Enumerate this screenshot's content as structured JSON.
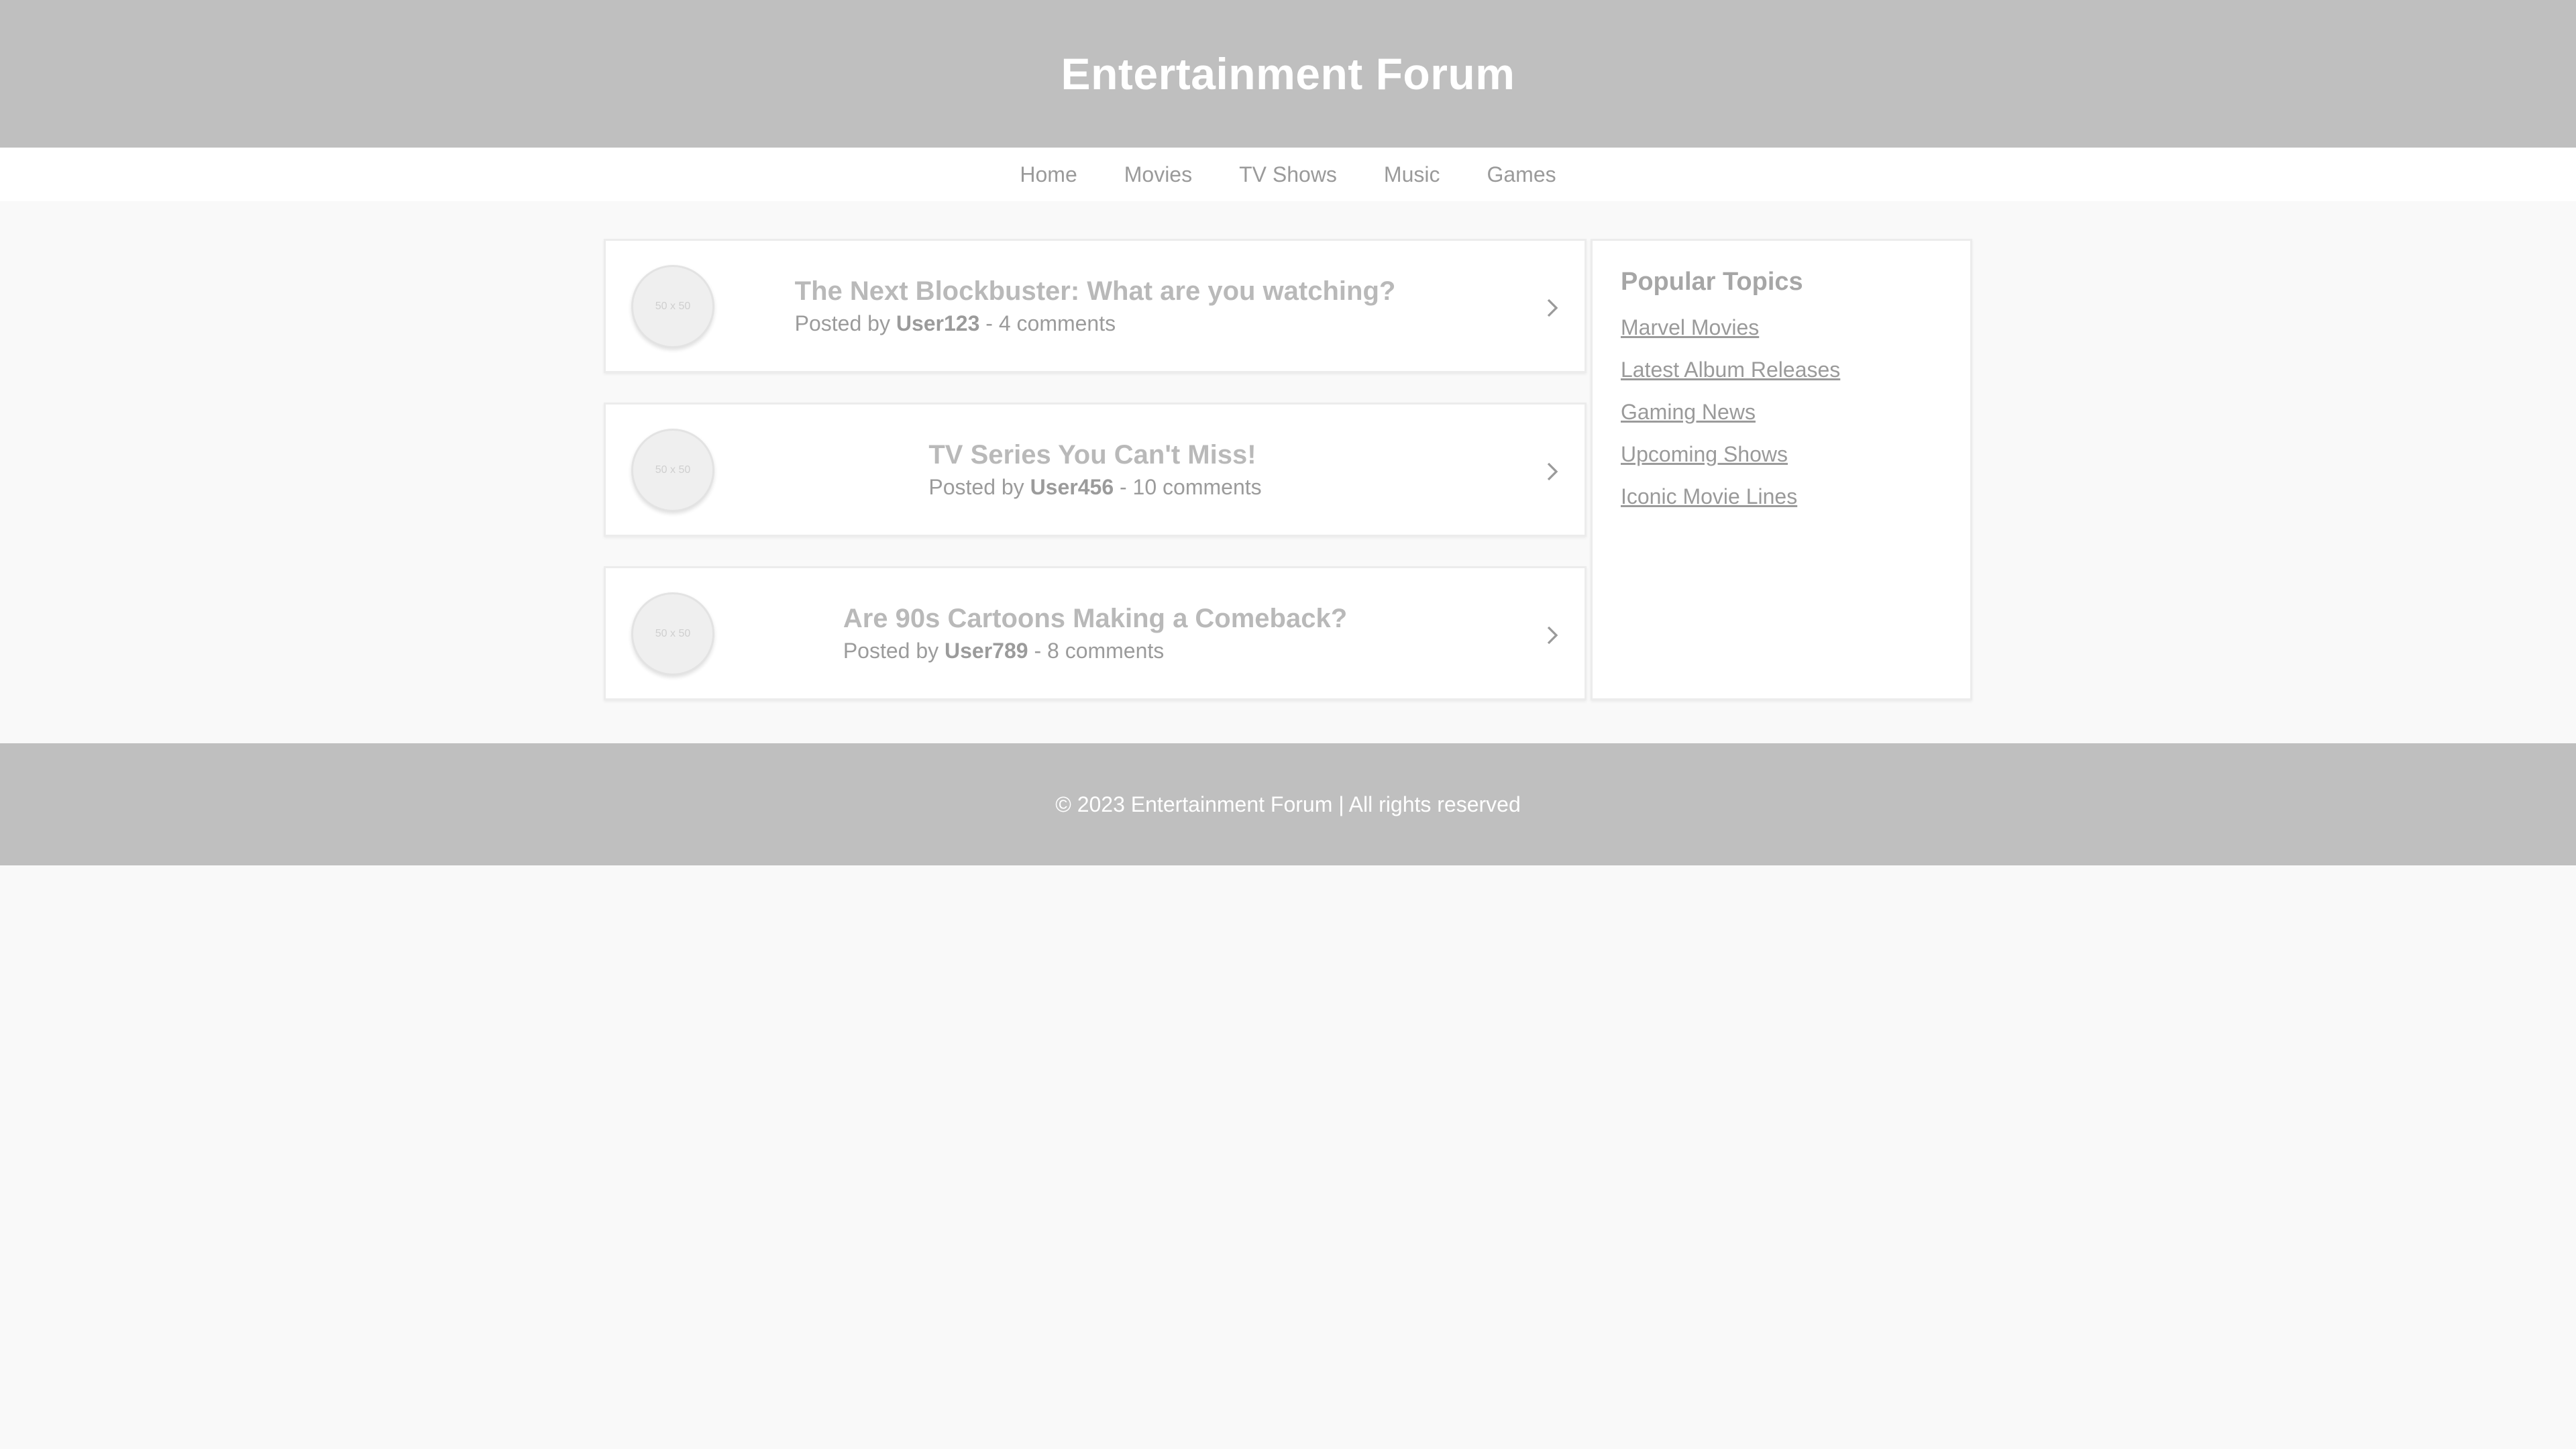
{
  "header": {
    "title": "Entertainment Forum"
  },
  "nav": {
    "items": [
      "Home",
      "Movies",
      "TV Shows",
      "Music",
      "Games"
    ]
  },
  "posts": [
    {
      "avatar_label": "50 x 50",
      "title": "The Next Blockbuster: What are you watching?",
      "meta_prefix": "Posted by ",
      "user": "User123",
      "meta_suffix": " - 4 comments"
    },
    {
      "avatar_label": "50 x 50",
      "title": "TV Series You Can't Miss!",
      "meta_prefix": "Posted by ",
      "user": "User456",
      "meta_suffix": " - 10 comments"
    },
    {
      "avatar_label": "50 x 50",
      "title": "Are 90s Cartoons Making a Comeback?",
      "meta_prefix": "Posted by ",
      "user": "User789",
      "meta_suffix": " - 8 comments"
    }
  ],
  "sidebar": {
    "title": "Popular Topics",
    "links": [
      "Marvel Movies",
      "Latest Album Releases",
      "Gaming News",
      "Upcoming Shows",
      "Iconic Movie Lines"
    ]
  },
  "footer": {
    "text": "© 2023 Entertainment Forum | All rights reserved"
  },
  "icons": {
    "post_arrow": "chevron-right-icon"
  },
  "colors": {
    "header_bg": "#bfbfbf",
    "page_bg": "#f9f9f9"
  }
}
